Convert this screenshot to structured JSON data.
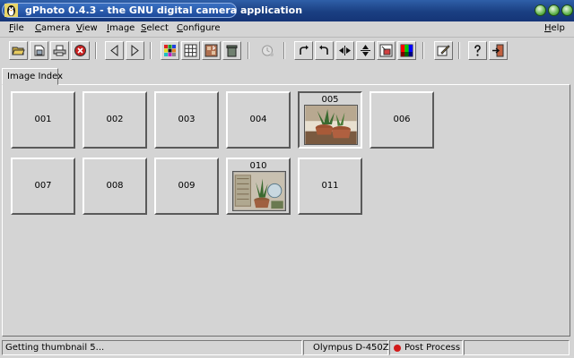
{
  "window": {
    "title": "gPhoto 0.4.3 - the GNU digital camera application"
  },
  "menu": {
    "left": [
      {
        "first": "F",
        "rest": "ile"
      },
      {
        "first": "C",
        "rest": "amera"
      },
      {
        "first": "V",
        "rest": "iew"
      },
      {
        "first": "I",
        "rest": "mage"
      },
      {
        "first": "S",
        "rest": "elect"
      },
      {
        "first": "C",
        "rest": "onfigure"
      }
    ],
    "help": {
      "first": "H",
      "rest": "elp"
    }
  },
  "toolbar": {
    "icons": [
      "open-folder-icon",
      "save-icon",
      "print-icon",
      "close-circle-icon",
      "previous-arrow-icon",
      "next-arrow-icon",
      "color-grid-icon",
      "thumbnail-grid-icon",
      "camera-download-icon",
      "trash-icon",
      "timer-icon",
      "rotate-right-icon",
      "rotate-left-icon",
      "flip-horizontal-icon",
      "flip-vertical-icon",
      "resize-icon",
      "colors-icon",
      "edit-icon",
      "help-icon",
      "exit-icon"
    ]
  },
  "tabs": [
    {
      "label": "Image Index"
    }
  ],
  "grid": {
    "rows": [
      [
        {
          "label": "001"
        },
        {
          "label": "002"
        },
        {
          "label": "003"
        },
        {
          "label": "004"
        },
        {
          "label": "005",
          "photo": true
        },
        {
          "label": "006"
        }
      ],
      [
        {
          "label": "007"
        },
        {
          "label": "008"
        },
        {
          "label": "009"
        },
        {
          "label": "010",
          "photo": true
        },
        {
          "label": "011"
        }
      ]
    ]
  },
  "status": {
    "message": "Getting thumbnail 5...",
    "camera": "Olympus D-450Z",
    "post_process": "Post Process"
  },
  "colors": {
    "titlebar": "#1a3f82",
    "background": "#d4d4d4",
    "post_process_dot": "#d21a1a"
  }
}
